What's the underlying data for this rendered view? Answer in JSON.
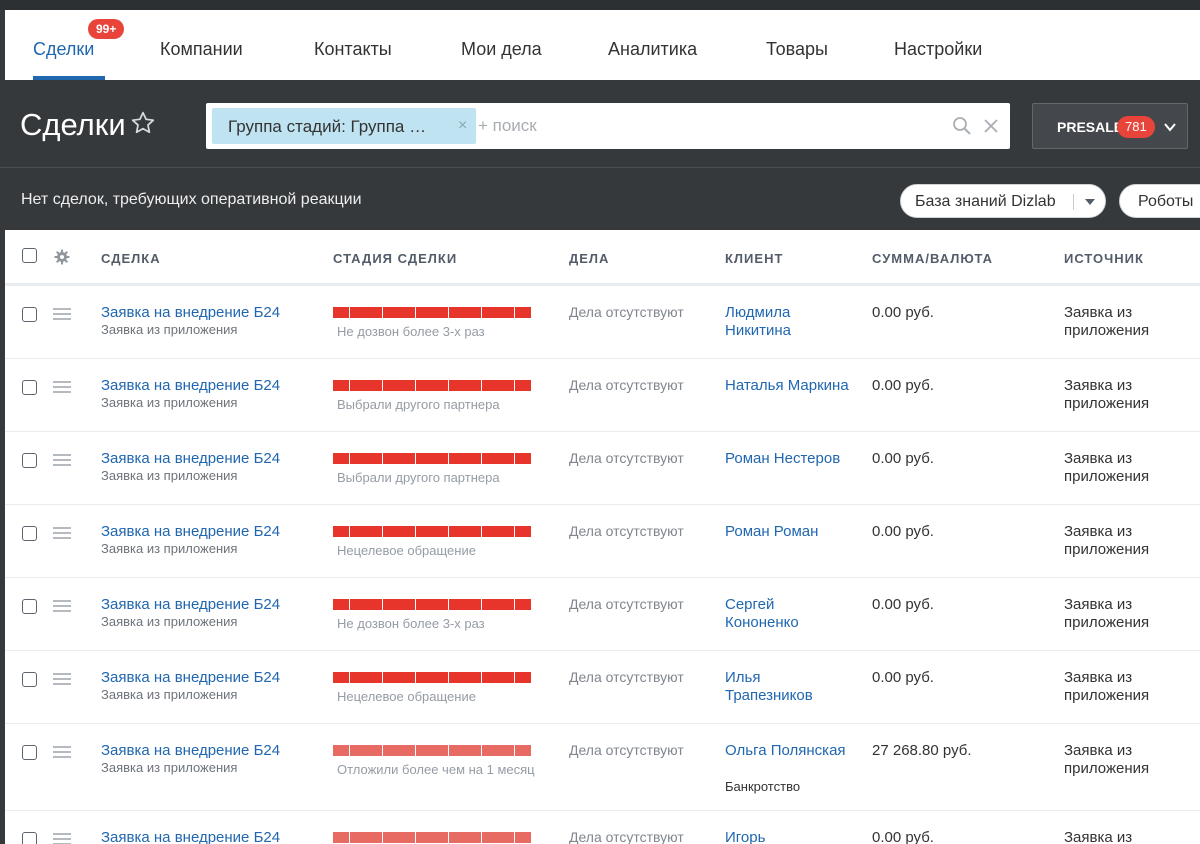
{
  "nav": {
    "tabs": [
      {
        "label": "Сделки",
        "active": true
      },
      {
        "label": "Компании"
      },
      {
        "label": "Контакты"
      },
      {
        "label": "Мои дела"
      },
      {
        "label": "Аналитика"
      },
      {
        "label": "Товары"
      },
      {
        "label": "Настройки"
      }
    ],
    "deals_badge": "99+"
  },
  "header": {
    "title": "Сделки",
    "filter": {
      "tag_label": "Группа стадий: Группа …",
      "tag_close": "×",
      "search_placeholder": "+ поиск"
    },
    "presale": {
      "label": "PRESALE",
      "count": "781"
    },
    "notice": "Нет сделок, требующих оперативной реакции",
    "kb_button": "База знаний Dizlab",
    "robots_button": "Роботы"
  },
  "grid": {
    "columns": [
      "СДЕЛКА",
      "СТАДИЯ СДЕЛКИ",
      "ДЕЛА",
      "КЛИЕНТ",
      "СУММА/ВАЛЮТА",
      "ИСТОЧНИК"
    ],
    "rows": [
      {
        "title": "Заявка на внедрение Б24",
        "subtitle": "Заявка из приложения",
        "stage": "Не дозвон более 3-х раз",
        "activity": "Дела отсутствуют",
        "client": "Людмила Никитина",
        "company": "",
        "amount": "0.00 руб.",
        "source": "Заявка из приложения"
      },
      {
        "title": "Заявка на внедрение Б24",
        "subtitle": "Заявка из приложения",
        "stage": "Выбрали другого партнера",
        "activity": "Дела отсутствуют",
        "client": "Наталья Маркина",
        "company": "",
        "amount": "0.00 руб.",
        "source": "Заявка из приложения"
      },
      {
        "title": "Заявка на внедрение Б24",
        "subtitle": "Заявка из приложения",
        "stage": "Выбрали другого партнера",
        "activity": "Дела отсутствуют",
        "client": "Роман Нестеров",
        "company": "",
        "amount": "0.00 руб.",
        "source": "Заявка из приложения"
      },
      {
        "title": "Заявка на внедрение Б24",
        "subtitle": "Заявка из приложения",
        "stage": "Нецелевое обращение",
        "activity": "Дела отсутствуют",
        "client": "Роман Роман",
        "company": "",
        "amount": "0.00 руб.",
        "source": "Заявка из приложения"
      },
      {
        "title": "Заявка на внедрение Б24",
        "subtitle": "Заявка из приложения",
        "stage": "Не дозвон более 3-х раз",
        "activity": "Дела отсутствуют",
        "client": "Сергей Кононенко",
        "company": "",
        "amount": "0.00 руб.",
        "source": "Заявка из приложения"
      },
      {
        "title": "Заявка на внедрение Б24",
        "subtitle": "Заявка из приложения",
        "stage": "Нецелевое обращение",
        "activity": "Дела отсутствуют",
        "client": "Илья Трапезников",
        "company": "",
        "amount": "0.00 руб.",
        "source": "Заявка из приложения"
      },
      {
        "title": "Заявка на внедрение Б24",
        "subtitle": "Заявка из приложения",
        "stage": "Отложили более чем на 1 месяц",
        "activity": "Дела отсутствуют",
        "client": "Ольга Полянская",
        "company": "Банкротство",
        "amount": "27 268.80 руб.",
        "source": "Заявка из приложения"
      },
      {
        "title": "Заявка на внедрение Б24",
        "subtitle": "",
        "stage": "",
        "activity": "Дела отсутствуют",
        "client": "Игорь",
        "company": "",
        "amount": "0.00 руб.",
        "source": "Заявка из"
      }
    ]
  },
  "colors": {
    "accent": "#2067b0",
    "badge": "#e8443a",
    "stage_lost": "#e8352b",
    "stage_postponed": "#e76b63",
    "header_bg": "#35393c"
  }
}
